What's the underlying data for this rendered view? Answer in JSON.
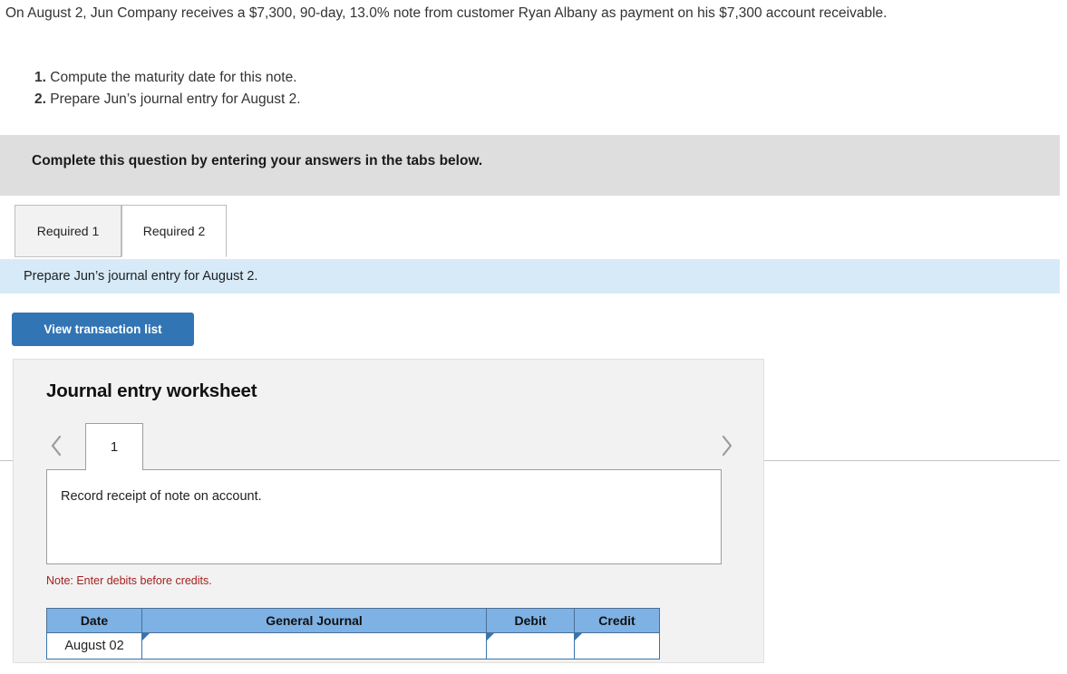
{
  "problem": {
    "statement": "On August 2, Jun Company receives a $7,300, 90-day, 13.0% note from customer Ryan Albany as payment on his $7,300 account receivable.",
    "requirements": [
      {
        "number": "1.",
        "text": "Compute the maturity date for this note."
      },
      {
        "number": "2.",
        "text": "Prepare Jun’s journal entry for August 2."
      }
    ]
  },
  "instruction_banner": {
    "text": "Complete this question by entering your answers in the tabs below."
  },
  "tabs": [
    {
      "label": "Required 1",
      "active": false
    },
    {
      "label": "Required 2",
      "active": true
    }
  ],
  "sub_instruction": {
    "text": "Prepare Jun’s journal entry for August 2."
  },
  "toolbar": {
    "view_transaction_list_label": "View transaction list"
  },
  "worksheet": {
    "title": "Journal entry worksheet",
    "prev_icon": "chevron-left-icon",
    "next_icon": "chevron-right-icon",
    "page_label": "1",
    "transaction_description": "Record receipt of note on account.",
    "debits_note": "Note: Enter debits before credits.",
    "table": {
      "headers": [
        "Date",
        "General Journal",
        "Debit",
        "Credit"
      ],
      "rows": [
        {
          "date": "August 02",
          "general_journal": "",
          "debit": "",
          "credit": ""
        }
      ]
    }
  },
  "colors": {
    "banner_gray": "#dedede",
    "sub_instruction_blue": "#d6eaf8",
    "button_blue": "#3275b5",
    "table_header_blue": "#7eb1e4",
    "panel_gray": "#f2f2f2",
    "note_red": "#a52020"
  }
}
